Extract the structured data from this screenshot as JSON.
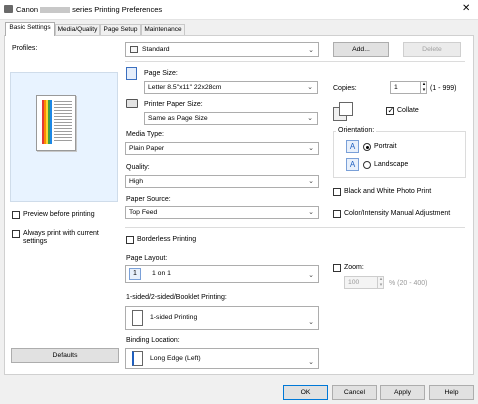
{
  "window": {
    "title_prefix": "Canon",
    "title_suffix": "series Printing Preferences",
    "close_glyph": "✕"
  },
  "tabs": [
    {
      "label": "Basic Settings",
      "active": true
    },
    {
      "label": "Media/Quality"
    },
    {
      "label": "Page Setup"
    },
    {
      "label": "Maintenance"
    }
  ],
  "profiles": {
    "label": "Profiles:",
    "value": "Standard",
    "add_label": "Add...",
    "delete_label": "Delete"
  },
  "left": {
    "preview_before_printing": "Preview before printing",
    "always_print_line1": "Always print with current",
    "always_print_line2": "settings",
    "defaults_label": "Defaults"
  },
  "page_size": {
    "label": "Page Size:",
    "value": "Letter 8.5\"x11\" 22x28cm"
  },
  "printer_paper_size": {
    "label": "Printer Paper Size:",
    "value": "Same as Page Size"
  },
  "media_type": {
    "label": "Media Type:",
    "value": "Plain Paper"
  },
  "quality": {
    "label": "Quality:",
    "value": "High"
  },
  "paper_source": {
    "label": "Paper Source:",
    "value": "Top Feed"
  },
  "copies": {
    "label": "Copies:",
    "value": "1",
    "range": "(1 - 999)",
    "collate_label": "Collate",
    "collate_checked": true
  },
  "orientation": {
    "label": "Orientation:",
    "portrait": "Portrait",
    "landscape": "Landscape",
    "portrait_icon": "A",
    "landscape_icon": "A"
  },
  "black_white": "Black and White Photo Print",
  "color_intensity": "Color/Intensity Manual Adjustment",
  "borderless": "Borderless Printing",
  "page_layout": {
    "label": "Page Layout:",
    "icon": "1",
    "value": "1 on 1"
  },
  "zoom": {
    "label": "Zoom:",
    "value": "100",
    "range": "% (20 - 400)"
  },
  "duplex": {
    "label": "1-sided/2-sided/Booklet Printing:",
    "value": "1-sided Printing"
  },
  "binding": {
    "label": "Binding Location:",
    "value": "Long Edge (Left)"
  },
  "footer": {
    "ok": "OK",
    "cancel": "Cancel",
    "apply": "Apply",
    "help": "Help"
  },
  "colors": {
    "accent": "#0078d7",
    "preview_bg": "#e8f3ff"
  }
}
